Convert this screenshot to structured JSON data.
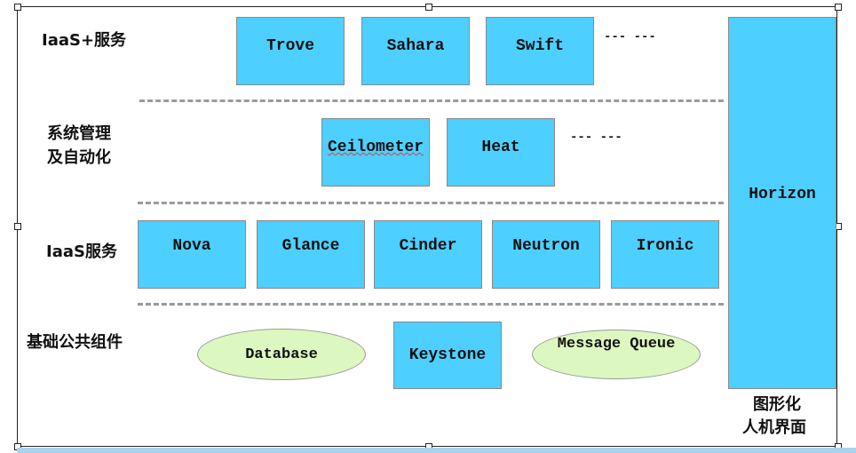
{
  "layers": {
    "iaas_plus": {
      "label": "IaaS+服务",
      "items": [
        "Trove",
        "Sahara",
        "Swift"
      ],
      "more": "--- ---"
    },
    "management": {
      "label_line1": "系统管理",
      "label_line2": "及自动化",
      "items": [
        "Ceilometer",
        "Heat"
      ],
      "more": "--- ---"
    },
    "iaas": {
      "label": "IaaS服务",
      "items": [
        "Nova",
        "Glance",
        "Cinder",
        "Neutron",
        "Ironic"
      ]
    },
    "common": {
      "label": "基础公共组件",
      "items": [
        "Database",
        "Keystone",
        "Message Queue"
      ]
    }
  },
  "dashboard": {
    "name": "Horizon",
    "caption_line1": "图形化",
    "caption_line2": "人机界面"
  },
  "colors": {
    "service_box": "#4dcfff",
    "common_ellipse": "#dcf7c0",
    "divider": "#9a9a9a"
  }
}
